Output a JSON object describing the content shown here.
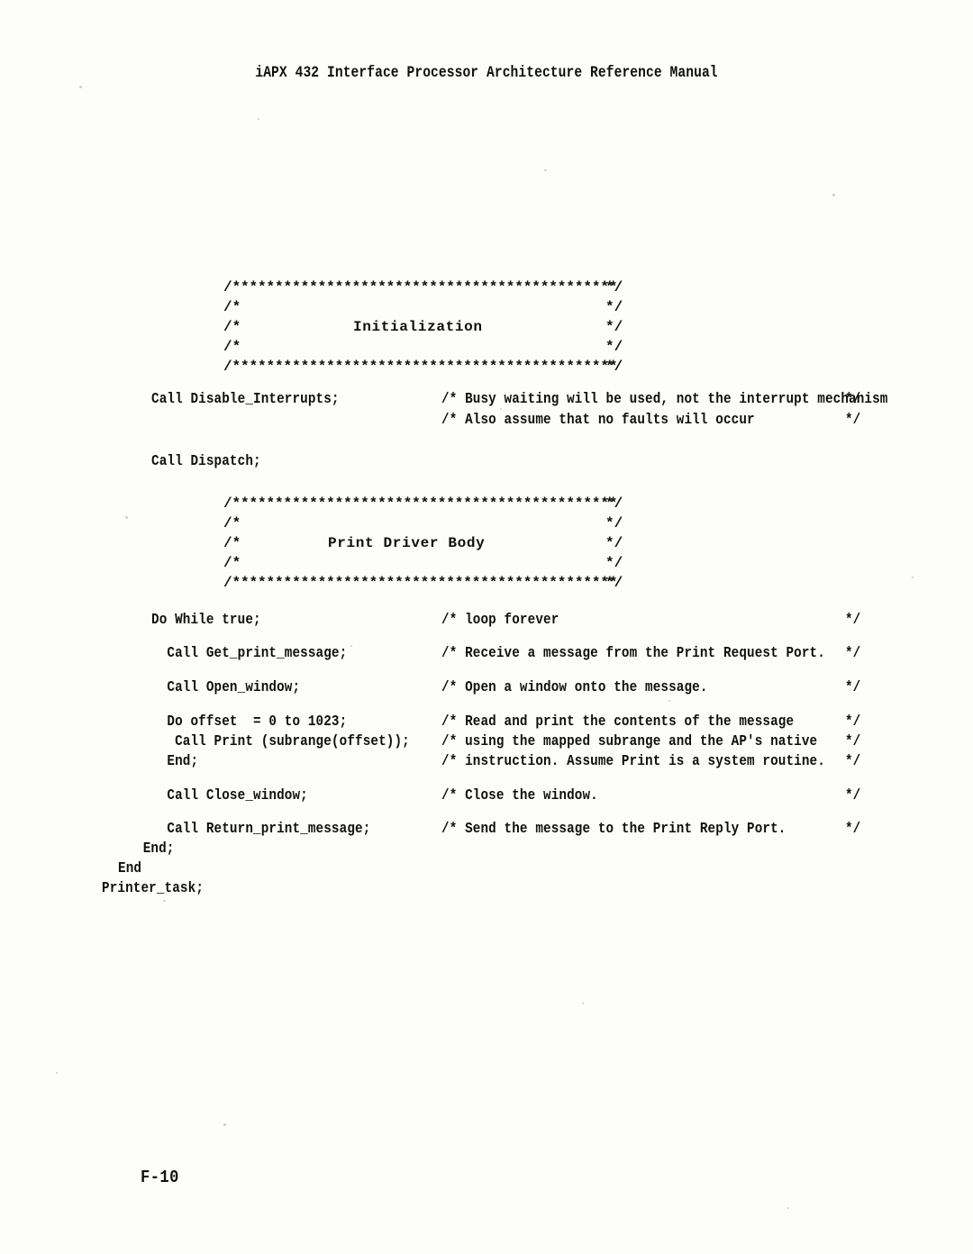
{
  "document": {
    "running_head": "iAPX 432 Interface Processor Architecture Reference Manual",
    "page_number": "F-10"
  },
  "banners": {
    "rule": "/*********************************************",
    "rule_end": "*/",
    "blank_open": "/*",
    "blank_end": "*/",
    "initialization": {
      "title": "Initialization"
    },
    "print_driver_body": {
      "title": "Print Driver Body"
    }
  },
  "listing": {
    "lines": [
      {
        "code": "Call Disable_Interrupts;",
        "comment": "/* Busy waiting will be used, not the interrupt mechanism",
        "end": "*/"
      },
      {
        "code": "",
        "comment": "/* Also assume that no faults will occur",
        "end": "*/"
      },
      {
        "code": "Call Dispatch;",
        "comment": "",
        "end": ""
      },
      {
        "code": "Do While true;",
        "comment": "/* loop forever",
        "end": "*/"
      },
      {
        "code": "  Call Get_print_message;",
        "comment": "/* Receive a message from the Print Request Port.",
        "end": "*/"
      },
      {
        "code": "  Call Open_window;",
        "comment": "/* Open a window onto the message.",
        "end": "*/"
      },
      {
        "code": "  Do offset  = 0 to 1023;",
        "comment": "/* Read and print the contents of the message",
        "end": "*/"
      },
      {
        "code": "   Call Print (subrange(offset));",
        "comment": "/* using the mapped subrange and the AP's native",
        "end": "*/"
      },
      {
        "code": "  End;",
        "comment": "/* instruction. Assume Print is a system routine.",
        "end": "*/"
      },
      {
        "code": "  Call Close_window;",
        "comment": "/* Close the window.",
        "end": "*/"
      },
      {
        "code": "  Call Return_print_message;",
        "comment": "/* Send the message to the Print Reply Port.",
        "end": "*/"
      },
      {
        "code": " End;",
        "comment": "",
        "end": ""
      },
      {
        "code": "End",
        "comment": "",
        "end": ""
      },
      {
        "code": "Printer_task;",
        "comment": "",
        "end": ""
      }
    ]
  }
}
